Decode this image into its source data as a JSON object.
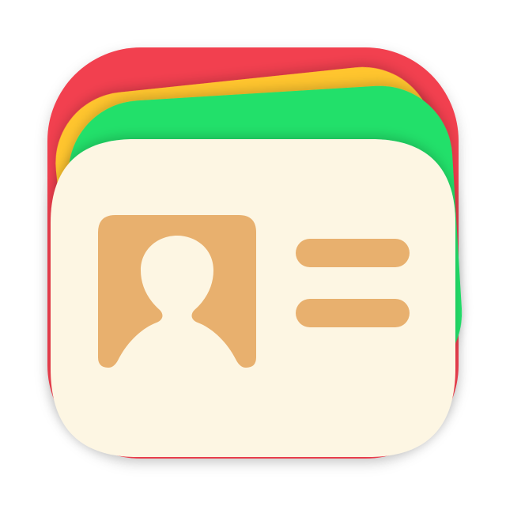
{
  "icon": {
    "name": "contact-cards-app-icon",
    "colors": {
      "background": "#ffffff",
      "card_red": "#f2404f",
      "card_yellow": "#ffc52e",
      "card_green": "#22e06a",
      "card_front": "#fdf6e3",
      "accent": "#e8b06e"
    },
    "glyphs": [
      "person-silhouette-icon",
      "text-lines-icon"
    ]
  }
}
